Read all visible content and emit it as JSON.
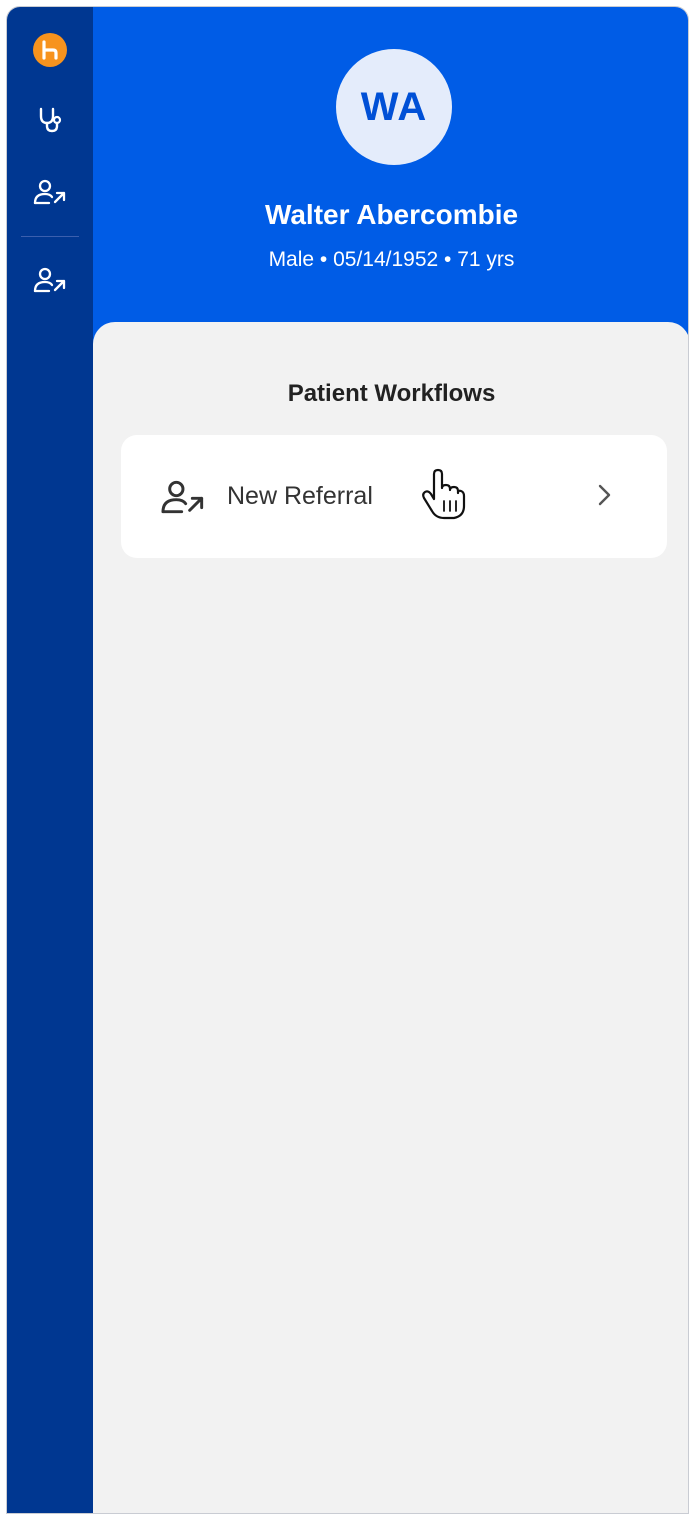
{
  "sidebar": {
    "items": [
      {
        "icon": "logo-icon",
        "label": ""
      },
      {
        "icon": "stethoscope-icon",
        "label": ""
      },
      {
        "icon": "user-referral-icon",
        "label": ""
      },
      {
        "icon": "user-referral-icon",
        "label": ""
      }
    ]
  },
  "patient": {
    "initials": "WA",
    "name": "Walter Abercombie",
    "meta": "Male • 05/14/1952 • 71 yrs"
  },
  "workflows": {
    "title": "Patient Workflows",
    "items": [
      {
        "label": "New Referral",
        "icon": "user-referral-icon",
        "action": "chevron-right-icon"
      }
    ]
  },
  "colors": {
    "sidebar": "#003791",
    "header": "#005ce6",
    "logo": "#f7931e",
    "panel": "#f2f2f2",
    "avatar_bg": "#e4ecfb"
  }
}
